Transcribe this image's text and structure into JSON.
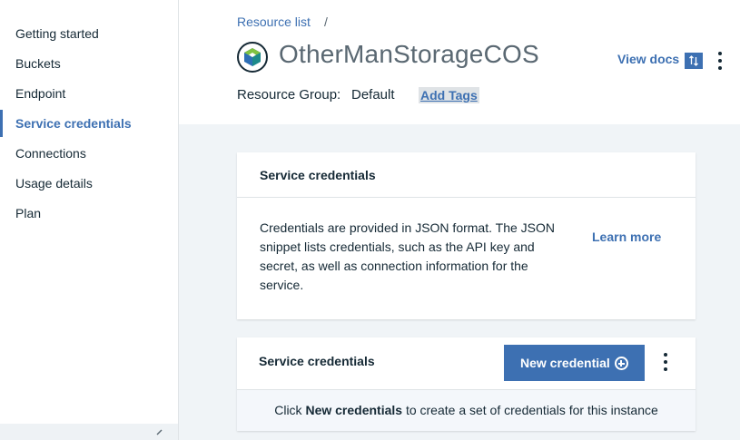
{
  "sidebar": {
    "items": [
      {
        "label": "Getting started"
      },
      {
        "label": "Buckets"
      },
      {
        "label": "Endpoint"
      },
      {
        "label": "Service credentials",
        "active": true
      },
      {
        "label": "Connections"
      },
      {
        "label": "Usage details"
      },
      {
        "label": "Plan"
      }
    ],
    "collapse_icon": "chevron-left-icon"
  },
  "header": {
    "breadcrumb": "Resource list",
    "breadcrumb_separator": "/",
    "title": "OtherManStorageCOS",
    "service_icon": "cloud-object-storage-icon",
    "resource_group_label": "Resource Group:",
    "resource_group_value": "Default",
    "add_tags": "Add Tags",
    "view_docs": "View docs",
    "docs_icon": "sort-arrows-icon",
    "overflow_icon": "overflow-menu-icon"
  },
  "info_card": {
    "title": "Service credentials",
    "description": "Credentials are provided in JSON format. The JSON snippet lists credentials, such as the API key and secret, as well as connection information for the service.",
    "learn_more": "Learn more"
  },
  "credentials_card": {
    "title": "Service credentials",
    "new_credential_label": "New credential",
    "new_credential_icon": "add-circle-icon",
    "overflow_icon": "overflow-menu-icon",
    "empty_prefix": "Click ",
    "empty_bold": "New credentials",
    "empty_suffix": " to create a set of credentials for this instance"
  },
  "colors": {
    "accent": "#3d70b2",
    "text": "#152935",
    "muted": "#5a6872",
    "background": "#f0f4f7"
  }
}
